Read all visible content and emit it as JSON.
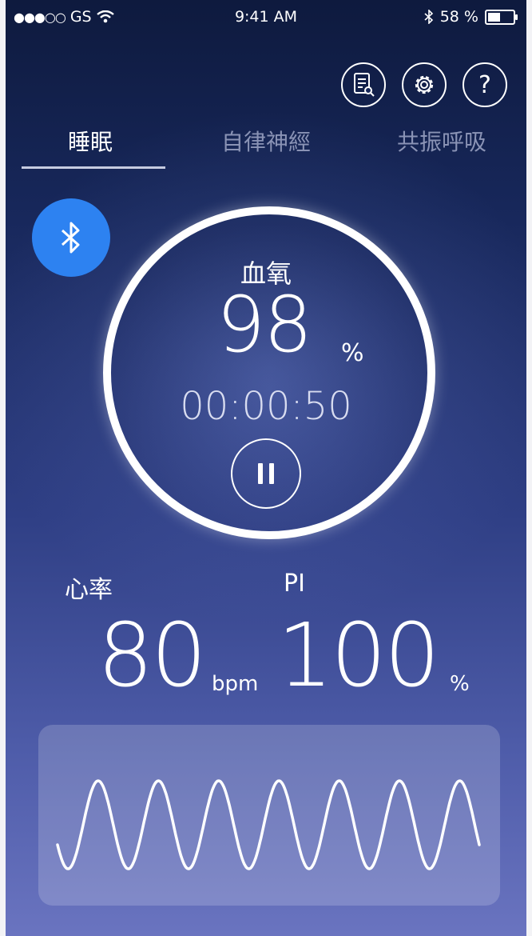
{
  "status_bar": {
    "carrier": "GS",
    "signal_dots": "●●●○○",
    "time": "9:41 AM",
    "battery": "58 %",
    "battery_level": 0.58
  },
  "toolbar": {
    "icons": [
      "report-icon",
      "gear-icon",
      "help-icon"
    ],
    "help_glyph": "?"
  },
  "tabs": [
    {
      "label": "睡眠",
      "active": true
    },
    {
      "label": "自律神經",
      "active": false
    },
    {
      "label": "共振呼吸",
      "active": false
    }
  ],
  "bluetooth_button": {
    "icon": "bluetooth-icon",
    "color": "#2d82f1"
  },
  "spo2": {
    "label": "血氧",
    "value": "98",
    "unit": "%",
    "elapsed": "00:00:50"
  },
  "heart_rate": {
    "label": "心率",
    "value": "80",
    "unit": "bpm"
  },
  "pi": {
    "label": "PI",
    "value": "100",
    "unit": "%"
  },
  "waveform": {
    "cycles": 7
  }
}
